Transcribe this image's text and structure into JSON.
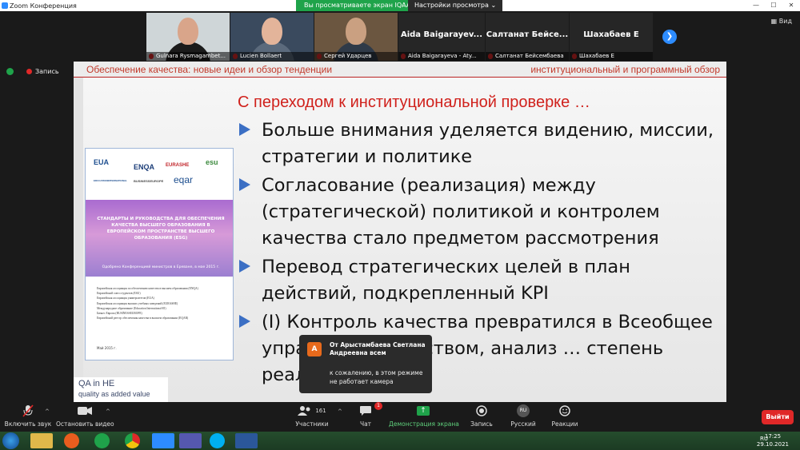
{
  "window": {
    "title": "Zoom Конференция",
    "share_banner": "Вы просматриваете экран IQAA",
    "view_options": "Настройки просмотра",
    "view_label": "Вид"
  },
  "participants": [
    {
      "name": "Gulnara Rysmagambet..."
    },
    {
      "name": "Lucien Bollaert"
    },
    {
      "name": "Сергей Ударцев"
    },
    {
      "big": "Aida  Baigarayev...",
      "name": "Aida Baigarayeva - Aty..."
    },
    {
      "big": "Салтанат  Бейсе...",
      "name": "Салтанат Бейсембаева"
    },
    {
      "big": "Шахабаев Е",
      "name": "Шахабаев Е"
    }
  ],
  "recording": {
    "label": "Запись"
  },
  "slide": {
    "header_left": "Обеспечение качества: новые идеи и обзор тенденции",
    "header_right": "институциональный и программный обзор",
    "title": "С переходом к институциональной проверке …",
    "bullets": [
      "Больше внимания уделяется видению, миссии, стратегии и политике",
      "Согласование (реализация) между (стратегической) политикой и контролем качества стало предметом рассмотрения",
      "Перевод стратегических целей в план действий, подкрепленный KPI",
      "(I) Контроль качества превратился в Всеобщее управление качеством, анализ … степень реализации"
    ],
    "doc": {
      "logos": [
        "EUA",
        "ENQA",
        "EURASHE",
        "esu",
        "EDUCATIONINTERNATIONAL",
        "BUSINESSEUROPE",
        "eqar"
      ],
      "title": "СТАНДАРТЫ И РУКОВОДСТВА ДЛЯ ОБЕСПЕЧЕНИЯ КАЧЕСТВА ВЫСШЕГО ОБРАЗОВАНИЯ В ЕВРОПЕЙСКОМ ПРОСТРАНСТВЕ ВЫСШЕГО ОБРАЗОВАНИЯ (ESG)",
      "subtitle": "Одобрено Конференцией министров в Ереване, в мае 2015 г.",
      "lines": [
        "Европейская ассоциация по обеспечению качества в высшем образовании (ENQA)",
        "Европейский союз студентов (ESU)",
        "Европейская ассоциация университетов (EUA)",
        "Европейская ассоциация высших учебных заведений (EURASHE)",
        "Международное образование (Education International-EI)",
        "Бизнес Европа (BUSINESSEUROPE)",
        "Европейский реестр обеспечения качества в высшем образовании (EQAR)"
      ],
      "date": "Май 2015 г."
    },
    "qa_line1": "QA in HE",
    "qa_line2": "quality as added value"
  },
  "chat_notification": {
    "avatar": "А",
    "from": "От Арыстамбаева Светлана Андреевна всем",
    "message": "к сожалению, в этом режиме не работает камера"
  },
  "toolbar": {
    "audio": "Включить звук",
    "video": "Остановить видео",
    "participants": "Участники",
    "participants_count": "161",
    "chat": "Чат",
    "chat_badge": "1",
    "share": "Демонстрация экрана",
    "record": "Запись",
    "language": "Русский",
    "language_code": "RU",
    "reactions": "Реакции",
    "leave": "Выйти"
  },
  "taskbar": {
    "lang": "RU",
    "time": "17:25",
    "date": "29.10.2021"
  }
}
